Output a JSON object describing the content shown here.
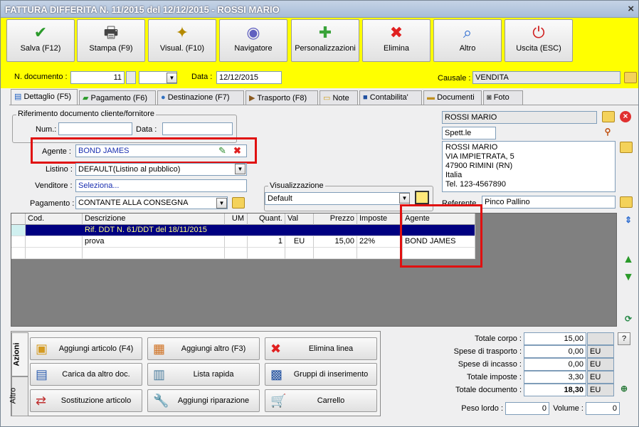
{
  "window": {
    "title": "FATTURA DIFFERITA N. 11/2015 del 12/12/2015 - ROSSI MARIO",
    "close": "×"
  },
  "toolbar": [
    {
      "label": "Salva (F12)",
      "icon": "check-icon",
      "glyph": "✔",
      "color": "#2a9a2a"
    },
    {
      "label": "Stampa (F9)",
      "icon": "printer-icon",
      "glyph": "🖶",
      "color": "#444"
    },
    {
      "label": "Visual. (F10)",
      "icon": "magic-wand-icon",
      "glyph": "✦",
      "color": "#b58a00"
    },
    {
      "label": "Navigatore",
      "icon": "compass-icon",
      "glyph": "◉",
      "color": "#6060c0"
    },
    {
      "label": "Personalizzazioni",
      "icon": "puzzle-icon",
      "glyph": "✚",
      "color": "#3aa33a"
    },
    {
      "label": "Elimina",
      "icon": "delete-icon",
      "glyph": "✖",
      "color": "#e02020"
    },
    {
      "label": "Altro",
      "icon": "magnifier-icon",
      "glyph": "⌕",
      "color": "#2a6ad0"
    },
    {
      "label": "Uscita (ESC)",
      "icon": "power-icon",
      "glyph": "⏻",
      "color": "#d02020"
    }
  ],
  "header": {
    "doc_label": "N. documento :",
    "doc_number": "11",
    "data_label": "Data :",
    "date": "12/12/2015",
    "causale_label": "Causale :",
    "causale": "VENDITA"
  },
  "tabs": [
    "Dettaglio (F5)",
    "Pagamento (F6)",
    "Destinazione (F7)",
    "Trasporto (F8)",
    "Note",
    "Contabilita'",
    "Documenti",
    "Foto"
  ],
  "riferimento": {
    "title": "Riferimento documento cliente/fornitore",
    "num_label": "Num.:",
    "data_label": "Data :",
    "num": "",
    "data": ""
  },
  "fields": {
    "agente_label": "Agente :",
    "agente": "BOND JAMES",
    "listino_label": "Listino :",
    "listino": "DEFAULT(Listino al pubblico)",
    "venditore_label": "Venditore :",
    "venditore": "Seleziona...",
    "pagamento_label": "Pagamento :",
    "pagamento": "CONTANTE ALLA CONSEGNA",
    "visual_title": "Visualizzazione",
    "visual": "Default"
  },
  "cliente": {
    "name": "ROSSI MARIO",
    "title": "Spett.le",
    "address": [
      "ROSSI MARIO",
      "VIA IMPIETRATA, 5",
      "47900 RIMINI (RN)",
      "Italia",
      "Tel.  123-4567890"
    ],
    "referente_label": "Referente",
    "referente": "Pinco Pallino"
  },
  "grid": {
    "headers": [
      "Cod.",
      "Descrizione",
      "UM",
      "Quant.",
      "Val",
      "Prezzo",
      "Imposte",
      "Agente"
    ],
    "rows": [
      {
        "cod": "",
        "desc": "Rif. DDT N. 61/DDT del 18/11/2015",
        "um": "",
        "qty": "",
        "val": "",
        "price": "",
        "tax": "",
        "agent": ""
      },
      {
        "cod": "",
        "desc": "prova",
        "um": "",
        "qty": "1",
        "val": "EU",
        "price": "15,00",
        "tax": "22%",
        "agent": "BOND JAMES"
      }
    ]
  },
  "actions": {
    "vtab_azioni": "Azioni",
    "vtab_altro": "Altro",
    "buttons": [
      {
        "label": "Aggiungi articolo (F4)",
        "icon": "box-add-icon",
        "glyph": "▣",
        "color": "#d49a20"
      },
      {
        "label": "Aggiungi altro (F3)",
        "icon": "grid-add-icon",
        "glyph": "▦",
        "color": "#d07020"
      },
      {
        "label": "Elimina linea",
        "icon": "delete-line-icon",
        "glyph": "✖",
        "color": "#e02020"
      },
      {
        "label": "Carica da altro doc.",
        "icon": "load-doc-icon",
        "glyph": "▤",
        "color": "#3060b0"
      },
      {
        "label": "Lista rapida",
        "icon": "quick-list-icon",
        "glyph": "▥",
        "color": "#5080a0"
      },
      {
        "label": "Gruppi di inserimento",
        "icon": "group-insert-icon",
        "glyph": "▩",
        "color": "#2050a0"
      },
      {
        "label": "Sostituzione articolo",
        "icon": "swap-icon",
        "glyph": "⇄",
        "color": "#c03030"
      },
      {
        "label": "Aggiungi riparazione",
        "icon": "wrench-icon",
        "glyph": "🔧",
        "color": "#666"
      },
      {
        "label": "Carrello",
        "icon": "cart-icon",
        "glyph": "🛒",
        "color": "#555"
      }
    ]
  },
  "totals": {
    "corpo_label": "Totale corpo :",
    "corpo": "15,00",
    "trasporto_label": "Spese di trasporto :",
    "trasporto": "0,00",
    "incasso_label": "Spese di incasso :",
    "incasso": "0,00",
    "imposte_label": "Totale imposte :",
    "imposte": "3,30",
    "documento_label": "Totale documento :",
    "documento": "18,30",
    "currency": "EU",
    "help": "?",
    "peso_label": "Peso lordo :",
    "peso": "0",
    "volume_label": "Volume :",
    "volume": "0"
  }
}
